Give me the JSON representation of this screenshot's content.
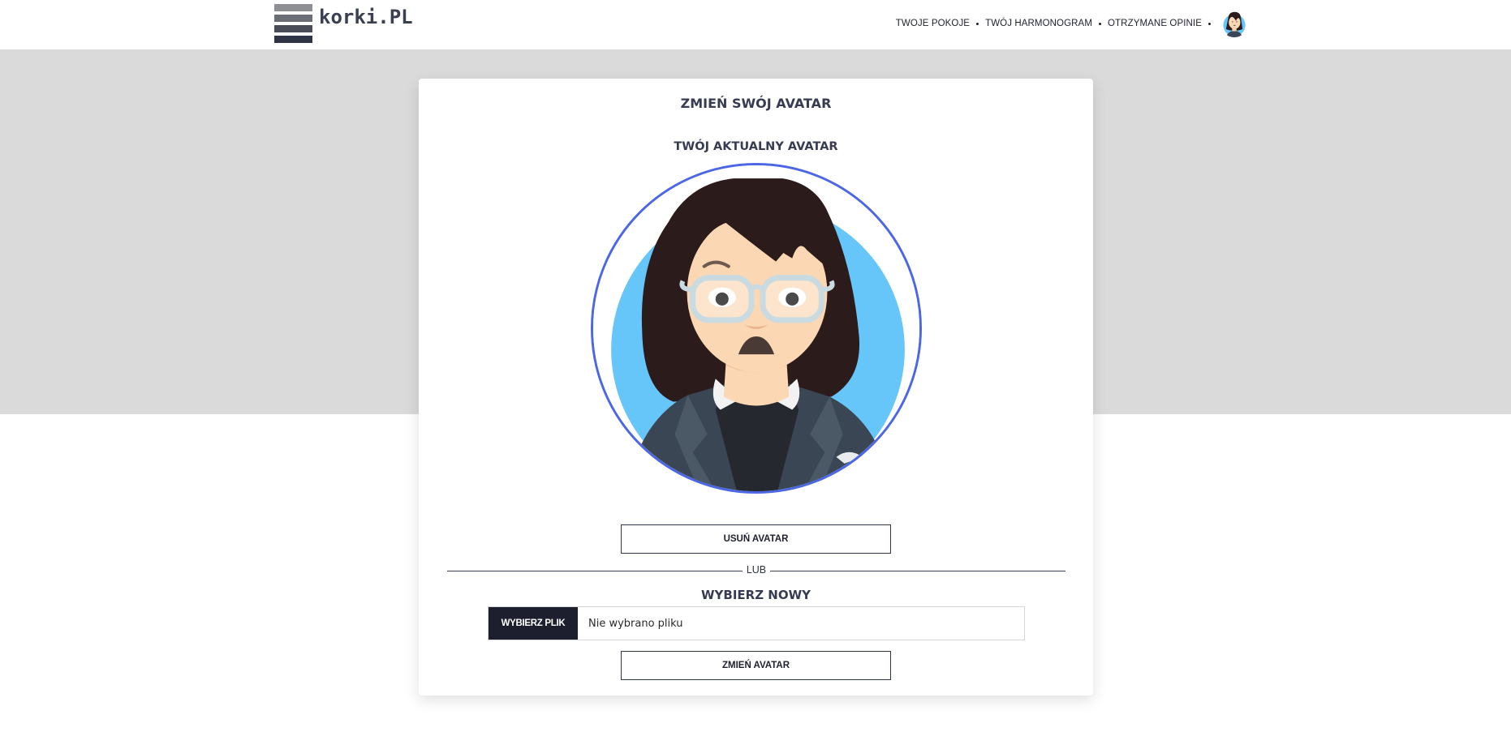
{
  "header": {
    "logo_text": "korki.PL",
    "nav": [
      {
        "label": "TWOJE POKOJE"
      },
      {
        "label": "TWÓJ HARMONOGRAM"
      },
      {
        "label": "OTRZYMANE OPINIE"
      }
    ]
  },
  "card": {
    "title": "ZMIEŃ SWÓJ AVATAR",
    "current_avatar_label": "TWÓJ AKTUALNY AVATAR",
    "remove_button": "USUŃ AVATAR",
    "or_text": "LUB",
    "new_label": "WYBIERZ NOWY",
    "file_button": "WYBIERZ PLIK",
    "file_status": "Nie wybrano pliku",
    "change_button": "ZMIEŃ AVATAR"
  },
  "colors": {
    "accent_ring": "#4c67e6",
    "avatar_bg": "#66c6fa",
    "dark": "#1e1f2e",
    "band": "#dadada"
  }
}
